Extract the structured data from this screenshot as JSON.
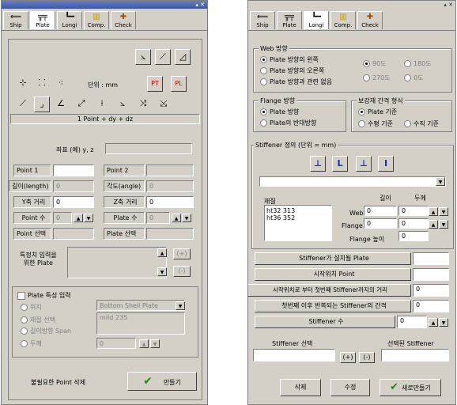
{
  "left": {
    "tabs": [
      {
        "label": "Ship",
        "icon": "ship-icon",
        "glyph": "⟸"
      },
      {
        "label": "Plate",
        "icon": "plate-icon",
        "glyph": "╦╤"
      },
      {
        "label": "Longi",
        "icon": "longi-icon",
        "glyph": "┗━"
      },
      {
        "label": "Comp.",
        "icon": "comp-icon",
        "glyph": "▥"
      },
      {
        "label": "Check",
        "icon": "check-icon",
        "glyph": "✚"
      }
    ],
    "unit_label": "단위 : mm",
    "formula": "1 Point + dy + dz",
    "coord_label": "좌표 (예) y, z",
    "point1": "Point 1",
    "point2": "Point 2",
    "length": "길이(length)",
    "length_val": "0",
    "angle": "각도(angle)",
    "angle_val": "0",
    "y_dist": "Y축 거리",
    "y_val": "0",
    "z_dist": "Z축 거리",
    "z_val": "0",
    "point_count": "Point 수",
    "point_count_val": "0",
    "plate_count": "Plate 수",
    "plate_count_val": "0",
    "point_select": "Point 선택",
    "plate_select": "Plate 선택",
    "special_input": "특정치 입력을\n위한 Plate",
    "plus": "(+)",
    "minus": "(-)",
    "plate_prop_check": "Plate 특성 입력",
    "pos_label": "위치",
    "pos_value": "Bottom Shell Plate",
    "material_label": "재질 선택",
    "material_value": "mild 235",
    "span_label": "길이방향 Span",
    "thick_label": "두께",
    "thick_val": "0",
    "delete_points": "불필요한 Point 삭제",
    "create": "만들기"
  },
  "right": {
    "tabs": [
      {
        "label": "Ship",
        "icon": "ship-icon",
        "glyph": "⟸"
      },
      {
        "label": "Plate",
        "icon": "plate-icon",
        "glyph": "╦╤"
      },
      {
        "label": "Longi",
        "icon": "longi-icon",
        "glyph": "┗━"
      },
      {
        "label": "Comp.",
        "icon": "comp-icon",
        "glyph": "▥"
      },
      {
        "label": "Check",
        "icon": "check-icon",
        "glyph": "✚"
      }
    ],
    "web_dir": "Web 방향",
    "web_opts": [
      "Plate 방향의 왼쪽",
      "Plate 방향의 오른쪽",
      "Plate 방향과 관련 없음"
    ],
    "angle_opts": [
      "90도",
      "180도",
      "270도",
      "0도"
    ],
    "flange_dir": "Flange 방향",
    "flange_opts": [
      "Plate 방향",
      "Plate의 반대방향"
    ],
    "spacing_type": "보강재 간격 형식",
    "spacing_opts": [
      "Plate 기준",
      "수평 기준",
      "수직 기준"
    ],
    "stiff_def": "Stiffener 정의 (단위 = mm)",
    "material": "재질",
    "length_col": "길이",
    "thick_col": "두께",
    "materials": [
      "ht32 313",
      "ht36 352"
    ],
    "web": "Web",
    "flange": "Flange",
    "flange_h": "Flange 높이",
    "zero": "0",
    "installed_plate": "Stiffener가 설치될 Plate",
    "start_point": "시작위치 Point",
    "first_dist": "시작위치로 부터 첫번째 Stiffener까지의 거리",
    "repeat_gap": "첫번째 이후 반복되는 Stiffener의 간격",
    "stiff_count": "Stiffener 수",
    "stiff_select": "Stiffener 선택",
    "selected_stiff": "선택된 Stiffener",
    "plus": "(+)",
    "minus": "(-)",
    "delete": "삭제",
    "modify": "수정",
    "new_create": "새로만들기"
  }
}
